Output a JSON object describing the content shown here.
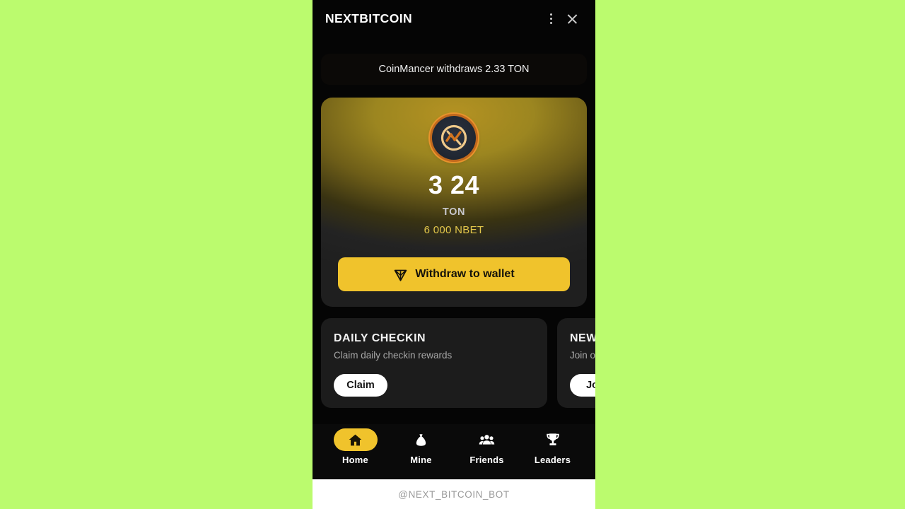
{
  "background": {
    "color": "#bbfb6e"
  },
  "header": {
    "title": "NEXTBITCOIN",
    "menu_icon": "kebab-menu-icon",
    "close_icon": "close-icon"
  },
  "ticker": {
    "message": "CoinMancer withdraws 2.33 TON"
  },
  "balance_card": {
    "logo_icon": "nextbitcoin-coin-logo",
    "amount": "3 24",
    "unit": "TON",
    "secondary_amount": "6 000 NBET",
    "withdraw_label": "Withdraw to wallet",
    "withdraw_icon": "ton-diamond-icon",
    "accent_color": "#f0c32c",
    "secondary_color": "#e3c74b"
  },
  "promos": [
    {
      "title": "DAILY CHECKIN",
      "subtitle": "Claim daily checkin rewards",
      "button": "Claim"
    },
    {
      "title": "NEWS CHANNEL",
      "subtitle": "Join our news channel",
      "button": "Join"
    }
  ],
  "bottom_nav": [
    {
      "label": "Home",
      "icon": "home-icon",
      "active": true
    },
    {
      "label": "Mine",
      "icon": "money-bag-icon",
      "active": false
    },
    {
      "label": "Friends",
      "icon": "friends-icon",
      "active": false
    },
    {
      "label": "Leaders",
      "icon": "trophy-icon",
      "active": false
    }
  ],
  "footer": {
    "handle": "@NEXT_BITCOIN_BOT"
  }
}
